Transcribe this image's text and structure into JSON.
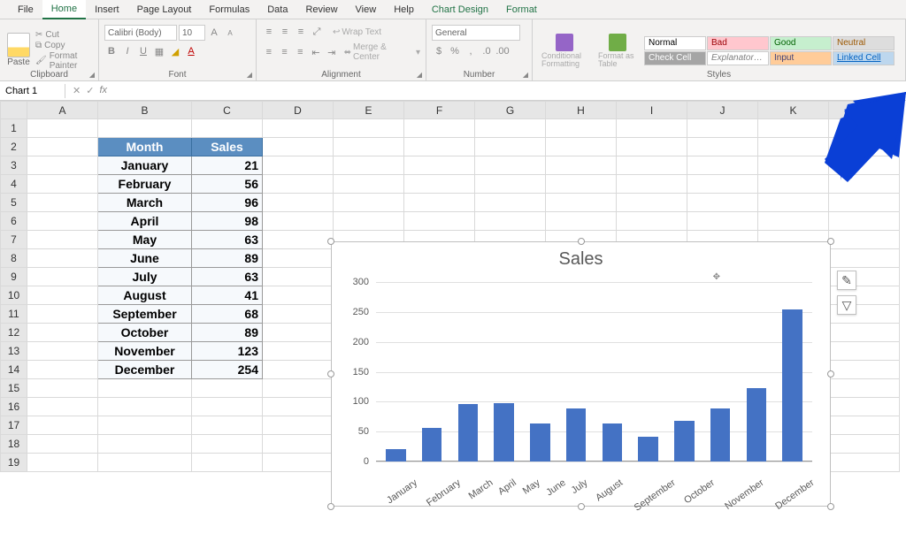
{
  "tabs": [
    "File",
    "Home",
    "Insert",
    "Page Layout",
    "Formulas",
    "Data",
    "Review",
    "View",
    "Help",
    "Chart Design",
    "Format"
  ],
  "active_tab": "Home",
  "clipboard": {
    "paste": "Paste",
    "cut": "Cut",
    "copy": "Copy",
    "format_painter": "Format Painter",
    "label": "Clipboard"
  },
  "font": {
    "name": "Calibri (Body)",
    "size": "10",
    "label": "Font"
  },
  "alignment": {
    "wrap": "Wrap Text",
    "merge": "Merge & Center",
    "label": "Alignment"
  },
  "number": {
    "format": "General",
    "label": "Number"
  },
  "styles": {
    "conditional": "Conditional Formatting",
    "format_as_table": "Format as Table",
    "cells": [
      [
        "Normal",
        "Bad",
        "Good",
        "Neutral"
      ],
      [
        "Check Cell",
        "Explanatory ...",
        "Input",
        "Linked Cell"
      ]
    ],
    "label": "Styles"
  },
  "name_box": "Chart 1",
  "columns": [
    "A",
    "B",
    "C",
    "D",
    "E",
    "F",
    "G",
    "H",
    "I",
    "J",
    "K",
    "L"
  ],
  "rows": 19,
  "table": {
    "headers": {
      "month": "Month",
      "sales": "Sales"
    },
    "data": [
      {
        "month": "January",
        "sales": 21
      },
      {
        "month": "February",
        "sales": 56
      },
      {
        "month": "March",
        "sales": 96
      },
      {
        "month": "April",
        "sales": 98
      },
      {
        "month": "May",
        "sales": 63
      },
      {
        "month": "June",
        "sales": 89
      },
      {
        "month": "July",
        "sales": 63
      },
      {
        "month": "August",
        "sales": 41
      },
      {
        "month": "September",
        "sales": 68
      },
      {
        "month": "October",
        "sales": 89
      },
      {
        "month": "November",
        "sales": 123
      },
      {
        "month": "December",
        "sales": 254
      }
    ]
  },
  "chart_data": {
    "type": "bar",
    "title": "Sales",
    "categories": [
      "January",
      "February",
      "March",
      "April",
      "May",
      "June",
      "July",
      "August",
      "September",
      "October",
      "November",
      "December"
    ],
    "values": [
      21,
      56,
      96,
      98,
      63,
      89,
      63,
      41,
      68,
      89,
      123,
      254
    ],
    "ylim": [
      0,
      300
    ],
    "y_ticks": [
      0,
      50,
      100,
      150,
      200,
      250,
      300
    ],
    "xlabel": "",
    "ylabel": ""
  }
}
